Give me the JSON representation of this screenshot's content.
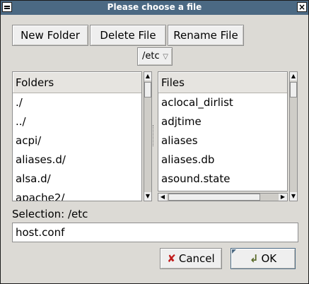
{
  "window": {
    "title": "Please choose a file"
  },
  "toolbar": {
    "new_folder": "New Folder",
    "delete_file": "Delete File",
    "rename_file": "Rename File"
  },
  "path_dropdown": {
    "value": "/etc"
  },
  "folders": {
    "header": "Folders",
    "items": [
      "./",
      "../",
      "acpi/",
      "aliases.d/",
      "alsa.d/",
      "apache2/"
    ]
  },
  "files": {
    "header": "Files",
    "items": [
      "aclocal_dirlist",
      "adjtime",
      "aliases",
      "aliases.db",
      "asound.state"
    ]
  },
  "selection": {
    "label": "Selection: /etc",
    "value": "host.conf"
  },
  "actions": {
    "cancel": "Cancel",
    "ok": "OK"
  },
  "icons": {
    "window_menu": "window-menu-icon",
    "close": "close-icon",
    "dropdown": "triangle-down-icon",
    "cancel": "x-icon",
    "ok": "check-arrow-icon"
  }
}
